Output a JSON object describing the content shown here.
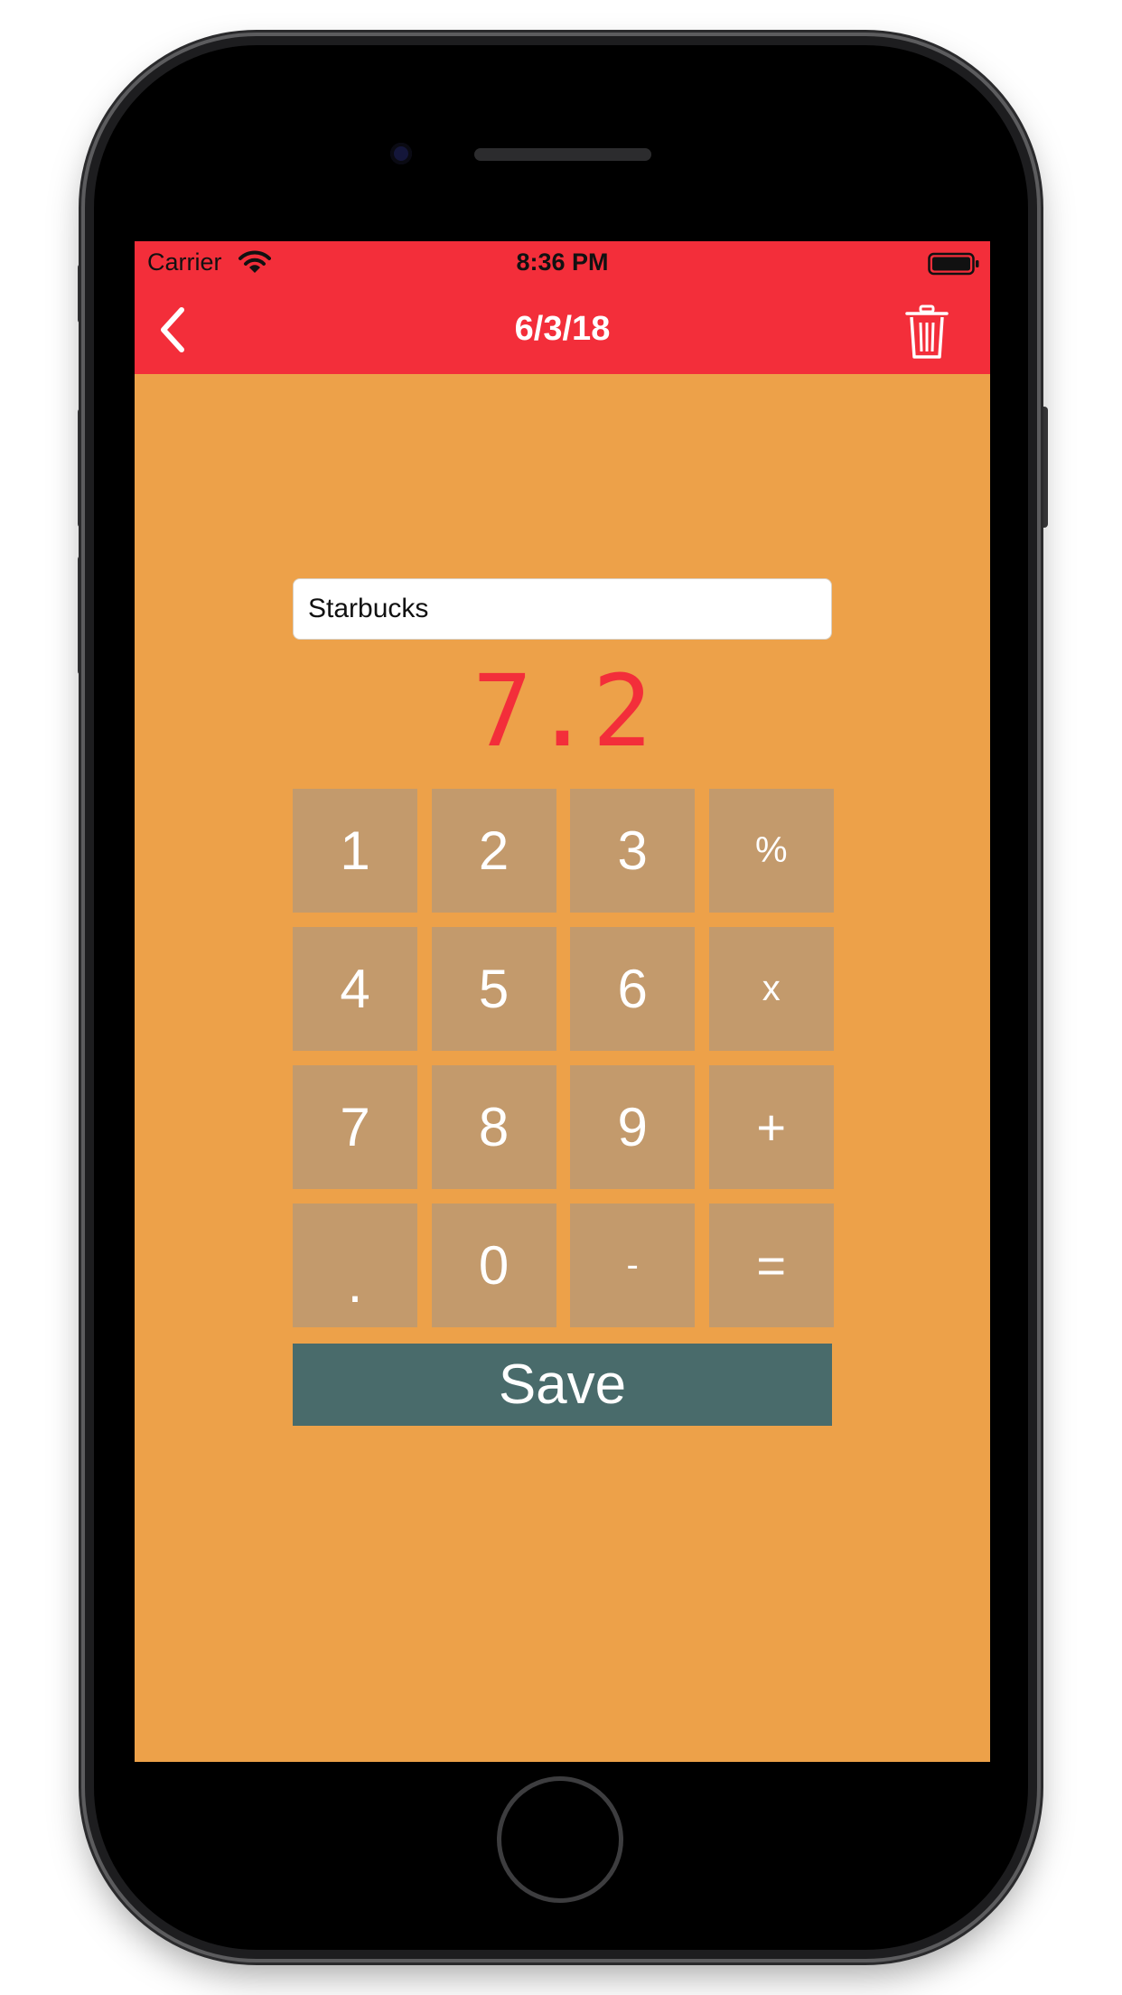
{
  "status_bar": {
    "carrier": "Carrier",
    "time": "8:36 PM"
  },
  "nav": {
    "title": "6/3/18",
    "back_icon": "chevron-left-icon",
    "delete_icon": "trash-icon"
  },
  "entry": {
    "name_value": "Starbucks",
    "amount": "7.2"
  },
  "keypad": {
    "keys": [
      "1",
      "2",
      "3",
      "%",
      "4",
      "5",
      "6",
      "x",
      "7",
      "8",
      "9",
      "+",
      ".",
      "0",
      "-",
      "="
    ]
  },
  "save_label": "Save",
  "colors": {
    "nav_red": "#f32e3a",
    "background_orange": "#eda149",
    "key_tan": "#c39a6c",
    "save_teal": "#496b6b",
    "amount_red": "#f32e3a"
  }
}
